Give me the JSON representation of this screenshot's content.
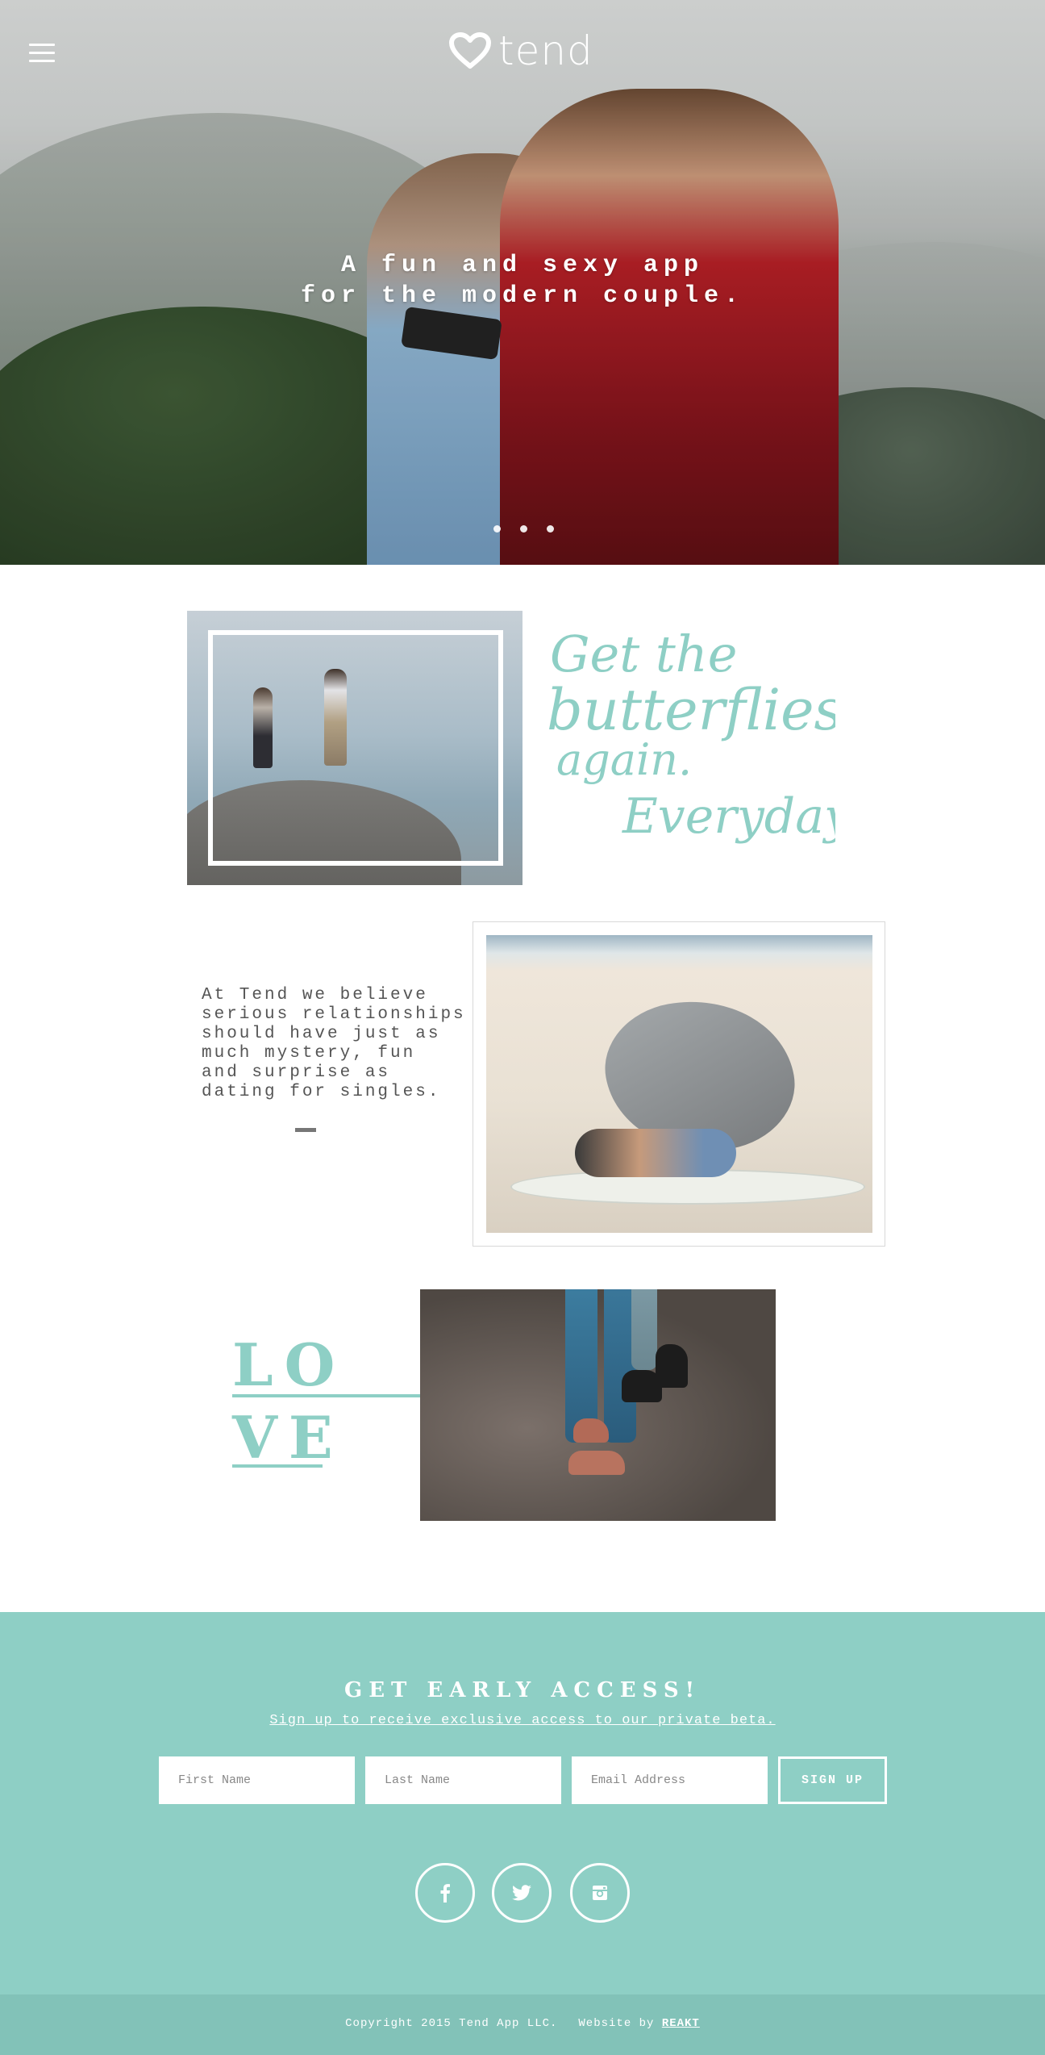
{
  "header": {
    "menu_icon": "hamburger-menu-icon",
    "logo_icon": "heart-icon",
    "logo_text": "tend"
  },
  "hero": {
    "tagline_line1": "A fun and sexy app",
    "tagline_line2": "for the modern couple.",
    "slides": 3,
    "active_slide": 1
  },
  "section1": {
    "script_line1": "Get the",
    "script_line2": "butterflies",
    "script_line3": "again.",
    "script_line4": "Everyday."
  },
  "section2": {
    "blurb_lines": [
      "At Tend we believe",
      "serious relationships",
      "should have just as",
      "much mystery, fun",
      "and surprise as",
      "dating for singles."
    ]
  },
  "section3": {
    "love_line1": "LO",
    "love_line2": "VE"
  },
  "signup": {
    "title": "GET EARLY ACCESS!",
    "subtitle": "Sign up to receive exclusive access to our private beta.",
    "first_name_placeholder": "First Name",
    "last_name_placeholder": "Last Name",
    "email_placeholder": "Email Address",
    "button_label": "SIGN UP",
    "social_icons": [
      "facebook-icon",
      "twitter-icon",
      "instagram-icon"
    ]
  },
  "footer": {
    "copyright": "Copyright 2015 Tend App LLC.",
    "website_by": "Website by",
    "agency": "REAKT"
  },
  "colors": {
    "accent": "#8ecfc5",
    "footer": "#82c2b8",
    "white": "#ffffff"
  }
}
